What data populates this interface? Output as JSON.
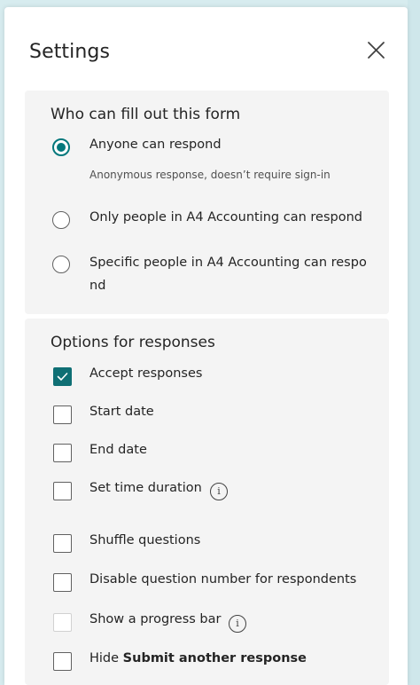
{
  "dialog": {
    "title": "Settings"
  },
  "who_can_fill": {
    "heading": "Who can fill out this form",
    "options": [
      {
        "label": "Anyone can respond",
        "description": "Anonymous response, doesn’t require sign-in",
        "selected": true
      },
      {
        "label": "Only people in A4 Accounting can respond",
        "selected": false
      },
      {
        "label": "Specific people in A4 Accounting can respond",
        "selected": false
      }
    ]
  },
  "options_for_responses": {
    "heading": "Options for responses",
    "items": [
      {
        "label": "Accept responses",
        "checked": true
      },
      {
        "label": "Start date",
        "checked": false
      },
      {
        "label": "End date",
        "checked": false
      },
      {
        "label": "Set time duration",
        "checked": false,
        "info_icon": true
      },
      {
        "label": "Shuffle questions",
        "checked": false
      },
      {
        "label": "Disable question number for respondents",
        "checked": false
      },
      {
        "label": "Show a progress bar",
        "checked": false,
        "disabled": true,
        "info_icon": true
      },
      {
        "label_prefix": "Hide ",
        "label_bold": "Submit another response",
        "checked": false
      }
    ]
  },
  "colors": {
    "accent": "#03787c",
    "card_bg": "#f4f4f4",
    "backdrop": "#d7ecef"
  }
}
